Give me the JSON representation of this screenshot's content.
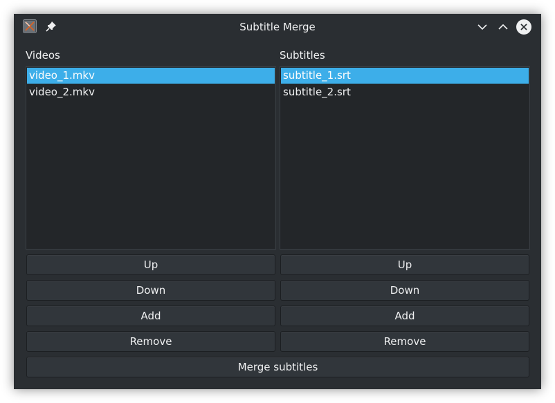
{
  "window": {
    "title": "Subtitle Merge",
    "app_icon": "app-icon",
    "pin_icon": "pin-icon",
    "controls": {
      "minimize_icon": "chevron-down-icon",
      "maximize_icon": "chevron-up-icon",
      "close_icon": "close-icon"
    }
  },
  "videos": {
    "label": "Videos",
    "items": [
      "video_1.mkv",
      "video_2.mkv"
    ],
    "selected_index": 0,
    "buttons": {
      "up": "Up",
      "down": "Down",
      "add": "Add",
      "remove": "Remove"
    }
  },
  "subtitles": {
    "label": "Subtitles",
    "items": [
      "subtitle_1.srt",
      "subtitle_2.srt"
    ],
    "selected_index": 0,
    "buttons": {
      "up": "Up",
      "down": "Down",
      "add": "Add",
      "remove": "Remove"
    }
  },
  "merge_button": "Merge subtitles",
  "colors": {
    "window_bg": "#2a2e32",
    "list_bg": "#232629",
    "selection": "#3daee9",
    "button_bg": "#31363b",
    "text": "#eff0f1"
  }
}
